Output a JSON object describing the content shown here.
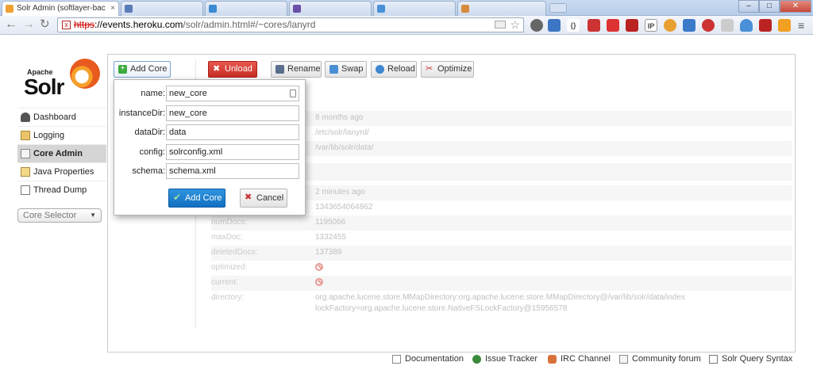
{
  "browser": {
    "active_tab_title": "Solr Admin (softlayer-bac",
    "background_tab_count": 5,
    "url": {
      "scheme": "https",
      "host": "://events.heroku.com",
      "path": "/solr/admin.html#/~cores/lanyrd"
    },
    "minimize": "–",
    "maximize": "□",
    "close": "✕",
    "extension_badges": [
      "{}",
      "IP"
    ],
    "colors": {
      "tab_bar": "#c9dbf2",
      "url_strike": "#cc0000"
    }
  },
  "logo": {
    "small": "Apache",
    "name": "Solr"
  },
  "sidebar": {
    "items": [
      {
        "label": "Dashboard",
        "icon": "dashboard-icon",
        "active": false
      },
      {
        "label": "Logging",
        "icon": "logging-icon",
        "active": false
      },
      {
        "label": "Core Admin",
        "icon": "core-admin-icon",
        "active": true
      },
      {
        "label": "Java Properties",
        "icon": "java-icon",
        "active": false
      },
      {
        "label": "Thread Dump",
        "icon": "thread-dump-icon",
        "active": false
      }
    ],
    "core_selector": "Core Selector"
  },
  "core_admin": {
    "add_core": "Add Core",
    "actions": {
      "unload": "Unload",
      "rename": "Rename",
      "swap": "Swap",
      "reload": "Reload",
      "optimize": "Optimize"
    }
  },
  "add_core_form": {
    "fields": [
      {
        "label": "name:",
        "value": "new_core"
      },
      {
        "label": "instanceDir:",
        "value": "new_core"
      },
      {
        "label": "dataDir:",
        "value": "data"
      },
      {
        "label": "config:",
        "value": "solrconfig.xml"
      },
      {
        "label": "schema:",
        "value": "schema.xml"
      }
    ],
    "submit": "Add Core",
    "cancel": "Cancel"
  },
  "core_details": {
    "core_rows": [
      {
        "key": "",
        "value": "8 months ago"
      },
      {
        "key": "",
        "value": "/etc/solr/lanyrd/"
      },
      {
        "key": "",
        "value": "/var/lib/solr/data/"
      }
    ],
    "index_rows": [
      {
        "key": "",
        "value": "2 minutes ago"
      },
      {
        "key": "",
        "value": "1343654064862"
      },
      {
        "key": "numDocs:",
        "value": "1195066"
      },
      {
        "key": "maxDoc:",
        "value": "1332455"
      },
      {
        "key": "deletedDocs:",
        "value": "137389"
      },
      {
        "key": "optimized:",
        "value": ""
      },
      {
        "key": "current:",
        "value": ""
      },
      {
        "key": "directory:",
        "value": "org.apache.lucene.store.MMapDirectory:org.apache.lucene.store.MMapDirectory@/var/lib/solr/data/index",
        "value2": "lockFactory=org.apache.lucene.store.NativeFSLockFactory@15956578"
      }
    ]
  },
  "footer": {
    "links": [
      {
        "label": "Documentation",
        "icon": "documentation-icon"
      },
      {
        "label": "Issue Tracker",
        "icon": "bug-icon"
      },
      {
        "label": "IRC Channel",
        "icon": "irc-icon"
      },
      {
        "label": "Community forum",
        "icon": "mail-icon"
      },
      {
        "label": "Solr Query Syntax",
        "icon": "query-syntax-icon"
      }
    ]
  }
}
